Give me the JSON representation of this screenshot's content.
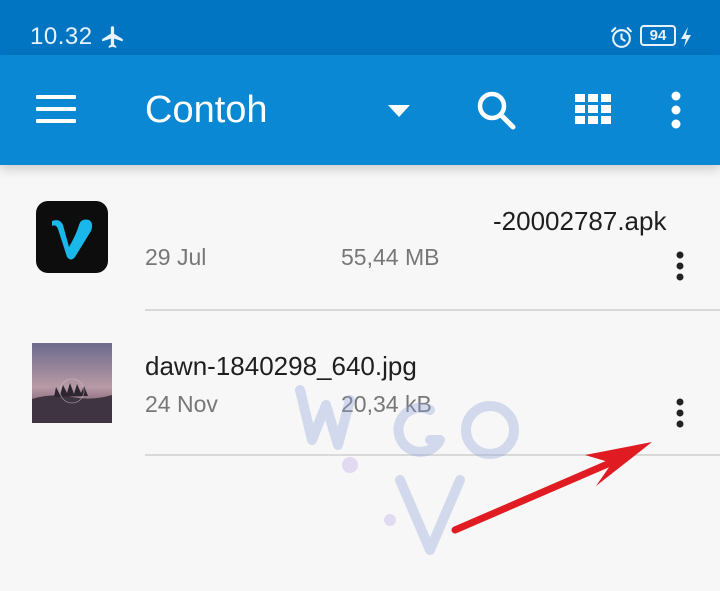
{
  "status_bar": {
    "time": "10.32",
    "battery": "94",
    "icons": [
      "airplane-icon",
      "alarm-icon",
      "charging-bolt-icon"
    ]
  },
  "app_bar": {
    "title": "Contoh",
    "icons": [
      "menu-icon",
      "dropdown-icon",
      "search-icon",
      "grid-view-icon",
      "more-vert-icon"
    ]
  },
  "files": [
    {
      "name": "-20002787.apk",
      "date": "29 Jul",
      "size": "55,44 MB",
      "thumbnail": "vimeo-app-icon"
    },
    {
      "name": "dawn-1840298_640.jpg",
      "date": "24 Nov",
      "size": "20,34 kB",
      "thumbnail": "dawn-photo-thumbnail"
    }
  ],
  "colors": {
    "status_bar": "#0275c2",
    "app_bar": "#0a88d3",
    "background": "#f7f7f7",
    "arrow": "#e11b22"
  }
}
